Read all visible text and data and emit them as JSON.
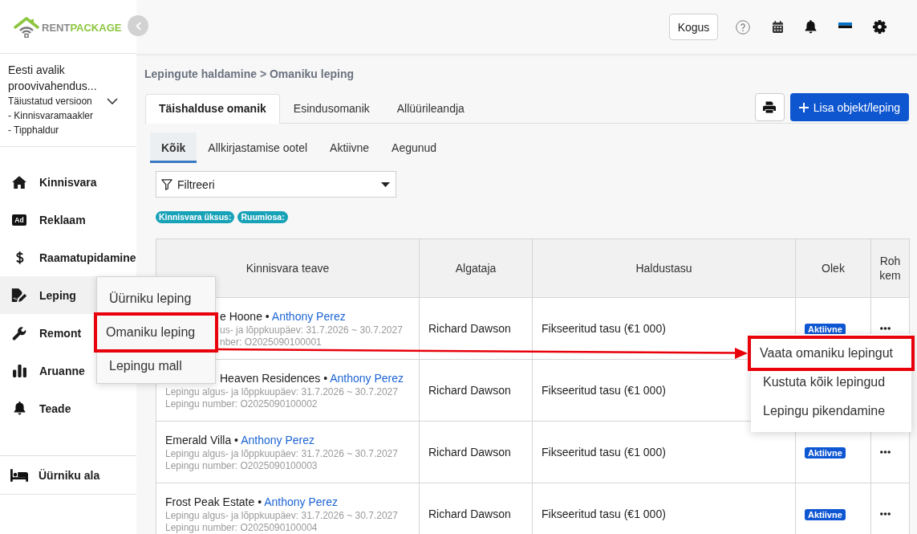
{
  "logo": {
    "text_1": "RENT",
    "text_2": "PACKAGE"
  },
  "account": {
    "name": "Eesti avalik proovivahendus...",
    "plan": "Täiustatud versioon",
    "roles": [
      "- Kinnisvaramaakler",
      "- Tipphaldur"
    ]
  },
  "sidebar": {
    "items": [
      {
        "kind": "house",
        "label": "Kinnisvara",
        "selected": false
      },
      {
        "kind": "ad",
        "icon_text": "Ad",
        "label": "Reklaam",
        "selected": false
      },
      {
        "kind": "dollar",
        "label": "Raamatupidamine",
        "selected": false
      },
      {
        "kind": "contract",
        "label": "Leping",
        "selected": true
      },
      {
        "kind": "wrench",
        "label": "Remont",
        "selected": false
      },
      {
        "kind": "chart",
        "label": "Aruanne",
        "selected": false
      },
      {
        "kind": "bell",
        "label": "Teade",
        "selected": false
      }
    ],
    "footer_items": [
      {
        "kind": "bed",
        "label": "Üürniku ala",
        "selected": false
      }
    ]
  },
  "topbar": {
    "button": "Kogus"
  },
  "breadcrumb": "Lepingute haldamine > Omaniku leping",
  "tabs": [
    {
      "label": "Täishalduse omanik",
      "selected": true
    },
    {
      "label": "Esindusomanik",
      "selected": false
    },
    {
      "label": "Allüürileandja",
      "selected": false
    }
  ],
  "add_button": "Lisa objekt/leping",
  "subtabs": [
    {
      "label": "Kõik",
      "selected": true
    },
    {
      "label": "Allkirjastamise ootel",
      "selected": false
    },
    {
      "label": "Aktiivne",
      "selected": false
    },
    {
      "label": "Aegunud",
      "selected": false
    }
  ],
  "filter": {
    "label": "Filtreeri"
  },
  "filter_tags": [
    "Kinnisvara üksus:",
    "Ruumiosa:"
  ],
  "table": {
    "columns": [
      "Kinnisvara teave",
      "Algataja",
      "Haldustasu",
      "Olek",
      "Rohkem"
    ],
    "rows": [
      {
        "title": "e Hoone •",
        "title_covered": true,
        "owner": "Anthony Perez",
        "dates": "us- ja lõppkuupäev: 31.7.2026 ~ 30.7.2027",
        "dates_covered": true,
        "number": "nber: O2025090100001",
        "number_covered": true,
        "initiator": "Richard Dawson",
        "fee": "Fikseeritud tasu (€1 000)",
        "status": "Aktiivne",
        "more": true
      },
      {
        "title": "Heaven Residences •",
        "title_covered": true,
        "owner": "Anthony Perez",
        "dates": "Lepingu algus- ja lõppkuupäev: 31.7.2026 ~ 30.7.2027",
        "dates_covered": false,
        "number": "Lepingu number: O2025090100002",
        "number_covered": false,
        "initiator": "Richard Dawson",
        "fee": "Fikseeritud tasu (€1 000)",
        "more": false
      },
      {
        "title": "Emerald Villa •",
        "title_covered": false,
        "owner": "Anthony Perez",
        "dates": "Lepingu algus- ja lõppkuupäev: 31.7.2026 ~ 30.7.2027",
        "dates_covered": false,
        "number": "Lepingu number: O2025090100003",
        "number_covered": false,
        "initiator": "Richard Dawson",
        "fee": "Fikseeritud tasu (€1 000)",
        "status": "Aktiivne",
        "more": true
      },
      {
        "title": "Frost Peak Estate •",
        "title_covered": false,
        "owner": "Anthony Perez",
        "dates": "Lepingu algus- ja lõppkuupäev: 31.7.2026 ~ 30.7.2027",
        "dates_covered": false,
        "number": "Lepingu number: O2025090100004",
        "number_covered": false,
        "initiator": "Richard Dawson",
        "fee": "Fikseeritud tasu (€1 000)",
        "status": "Aktiivne",
        "more": true
      }
    ]
  },
  "submenu": {
    "items": [
      {
        "label": "Üürniku leping",
        "highlighted": false
      },
      {
        "label": "Omaniku leping",
        "highlighted": true
      },
      {
        "label": "Lepingu mall",
        "highlighted": false
      }
    ]
  },
  "actions_menu": {
    "items": [
      {
        "label": "Vaata omaniku lepingut",
        "highlighted": true
      },
      {
        "label": "Kustuta kõik lepingud",
        "highlighted": false
      },
      {
        "label": "Lepingu pikendamine",
        "highlighted": false
      }
    ]
  }
}
